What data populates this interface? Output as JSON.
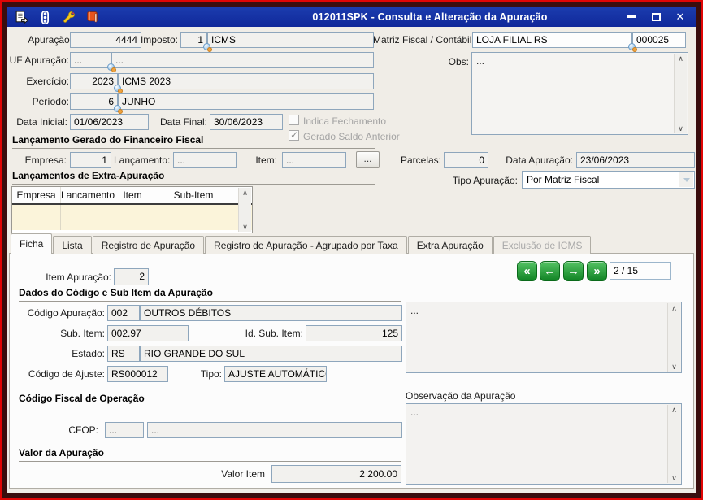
{
  "window": {
    "title": "012011SPK - Consulta e Alteração da Apuração",
    "titlebar_icons": [
      "export-icon",
      "traffic-light-icon",
      "wrench-icon",
      "book-icon"
    ],
    "controls": [
      "minimize",
      "maximize",
      "close"
    ]
  },
  "colors": {
    "titlebar_blue": "#1b3cae",
    "frame_red": "#e00505",
    "frame_maroon": "#3a0d0d",
    "field_border": "#8ea6bc",
    "table_row_cream": "#fbf4da",
    "nav_green": "#128425",
    "disabled_text": "#a3a3a3"
  },
  "form": {
    "apuracao": {
      "label": "Apuração:",
      "value": "4444"
    },
    "imposto": {
      "label": "Imposto:",
      "code": "1",
      "desc": "ICMS"
    },
    "matriz": {
      "label": "Matriz Fiscal / Contábil:",
      "name": "LOJA FILIAL RS",
      "code": "000025"
    },
    "uf": {
      "label": "UF Apuração:",
      "code": "...",
      "desc": "..."
    },
    "obs": {
      "label": "Obs:",
      "value": "..."
    },
    "exercicio": {
      "label": "Exercício:",
      "code": "2023",
      "desc": "ICMS 2023"
    },
    "periodo": {
      "label": "Período:",
      "code": "6",
      "desc": "JUNHO"
    },
    "data_inicial": {
      "label": "Data Inicial:",
      "value": "01/06/2023"
    },
    "data_final": {
      "label": "Data Final:",
      "value": "30/06/2023"
    },
    "indica_fechamento": {
      "label": "Indica Fechamento",
      "checked": false
    },
    "gerado_saldo": {
      "label": "Gerado Saldo Anterior",
      "checked": true
    }
  },
  "financeiro": {
    "section_title": "Lançamento Gerado do Financeiro Fiscal",
    "empresa": {
      "label": "Empresa:",
      "value": "1"
    },
    "lancamento": {
      "label": "Lançamento:",
      "value": "..."
    },
    "item": {
      "label": "Item:",
      "value": "..."
    },
    "browse_button": "...",
    "parcelas": {
      "label": "Parcelas:",
      "value": "0"
    },
    "data_apuracao": {
      "label": "Data Apuração:",
      "value": "23/06/2023"
    }
  },
  "extra": {
    "section_title": "Lançamentos de Extra-Apuração",
    "table": {
      "headers": [
        "Empresa",
        "Lancamento",
        "Item",
        "Sub-Item"
      ],
      "rows": [
        [
          "",
          "",
          "",
          ""
        ]
      ]
    },
    "tipo_apuracao": {
      "label": "Tipo Apuração:",
      "value": "Por Matriz Fiscal"
    }
  },
  "tabs": [
    {
      "label": "Ficha",
      "active": true
    },
    {
      "label": "Lista"
    },
    {
      "label": "Registro de Apuração"
    },
    {
      "label": "Registro de Apuração - Agrupado por Taxa"
    },
    {
      "label": "Extra Apuração"
    },
    {
      "label": "Exclusão de ICMS",
      "disabled": true
    }
  ],
  "ficha": {
    "item_apuracao": {
      "label": "Item Apuração:",
      "value": "2"
    },
    "nav": {
      "first": "«",
      "prev": "←",
      "next": "→",
      "last": "»",
      "position": "2 / 15"
    },
    "dados": {
      "section_title": "Dados do Código e Sub Item da Apuração",
      "codigo_apuracao": {
        "label": "Código Apuração:",
        "code": "002",
        "desc": "OUTROS DÉBITOS"
      },
      "sub_item": {
        "label": "Sub. Item:",
        "value": "002.97"
      },
      "id_sub_item": {
        "label": "Id. Sub. Item:",
        "value": "125"
      },
      "estado": {
        "label": "Estado:",
        "code": "RS",
        "desc": "RIO GRANDE DO SUL"
      },
      "codigo_ajuste": {
        "label": "Código de Ajuste:",
        "value": "RS000012"
      },
      "tipo": {
        "label": "Tipo:",
        "value": "AJUSTE AUTOMÁTICO"
      },
      "notes": "..."
    },
    "cfop_section": {
      "section_title": "Código Fiscal de Operação",
      "cfop": {
        "label": "CFOP:",
        "code": "...",
        "desc": "..."
      }
    },
    "observacao": {
      "label": "Observação da Apuração",
      "value": "..."
    },
    "valor_section": {
      "section_title": "Valor da Apuração",
      "valor_item": {
        "label": "Valor Item",
        "value": "2 200.00"
      }
    }
  }
}
